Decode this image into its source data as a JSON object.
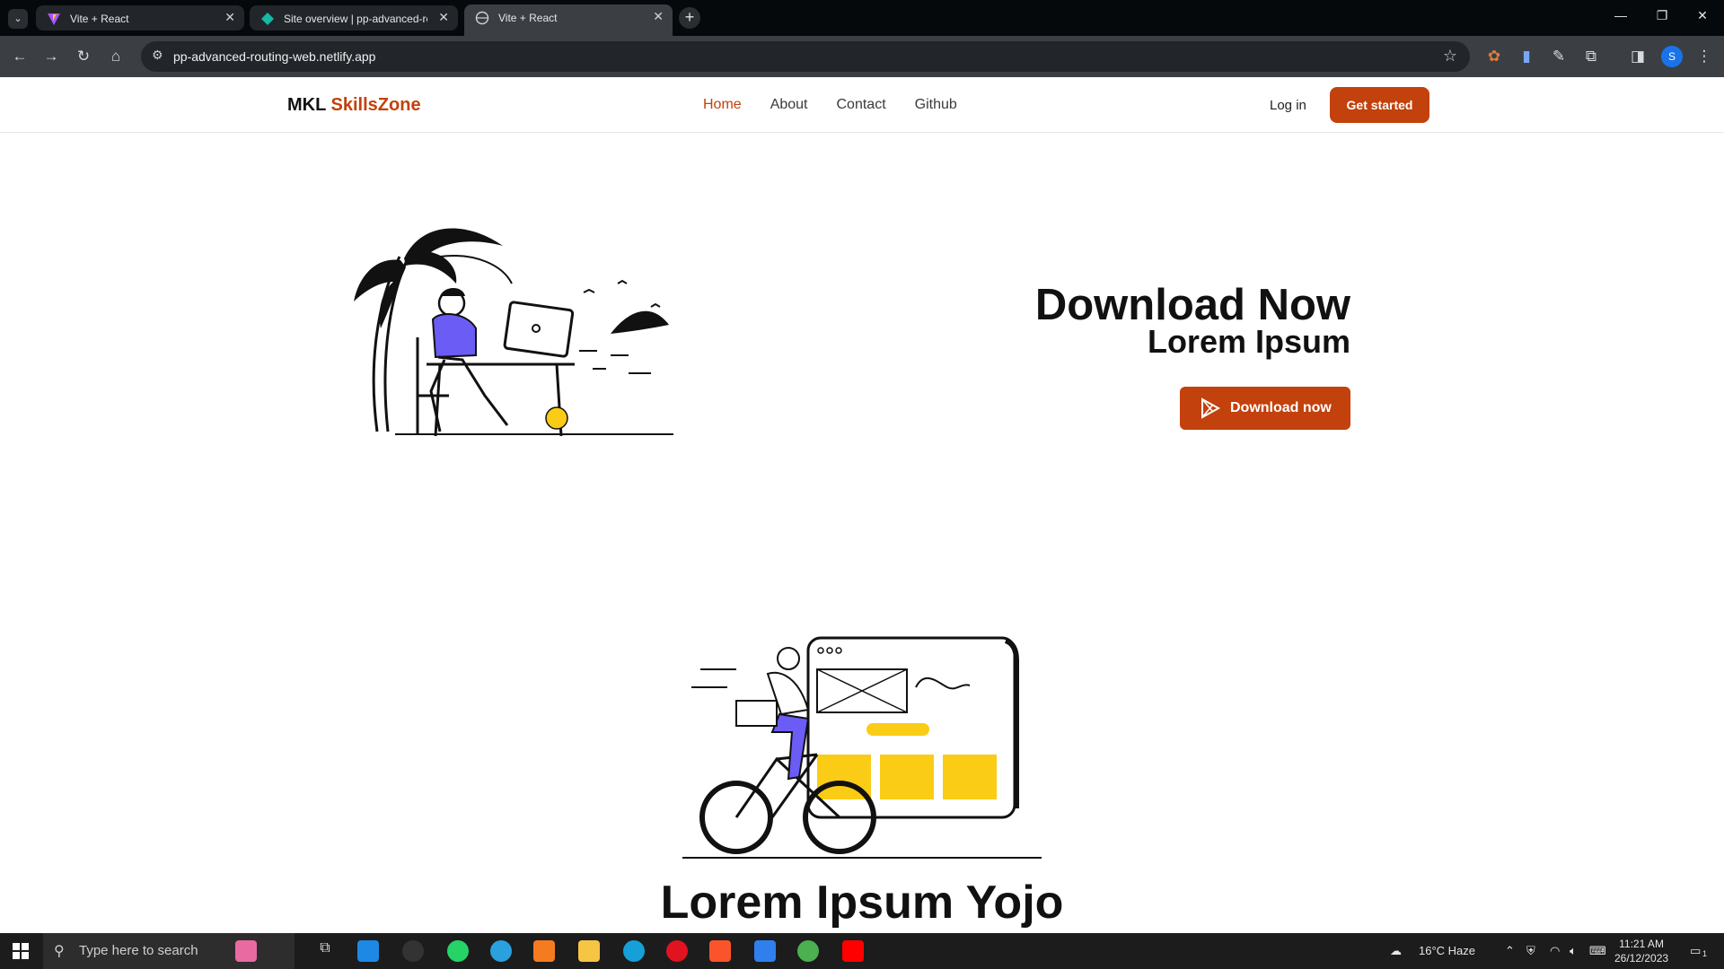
{
  "browser": {
    "tabs": [
      {
        "title": "Vite + React",
        "active": false
      },
      {
        "title": "Site overview | pp-advanced-ro",
        "active": false
      },
      {
        "title": "Vite + React",
        "active": true
      }
    ],
    "url": "pp-advanced-routing-web.netlify.app",
    "profile_initial": "S"
  },
  "site": {
    "brand_prefix": "MKL",
    "brand_accent": "SkillsZone",
    "nav": [
      "Home",
      "About",
      "Contact",
      "Github"
    ],
    "active_nav": "Home",
    "login_label": "Log in",
    "cta_label": "Get started",
    "hero": {
      "title": "Download Now",
      "subtitle": "Lorem Ipsum",
      "button_label": "Download now"
    },
    "section2_title": "Lorem Ipsum Yojo",
    "accent_color": "#c2410c"
  },
  "taskbar": {
    "search_placeholder": "Type here to search",
    "weather": "16°C  Haze",
    "time": "11:21 AM",
    "date": "26/12/2023",
    "notification_count": "1"
  }
}
